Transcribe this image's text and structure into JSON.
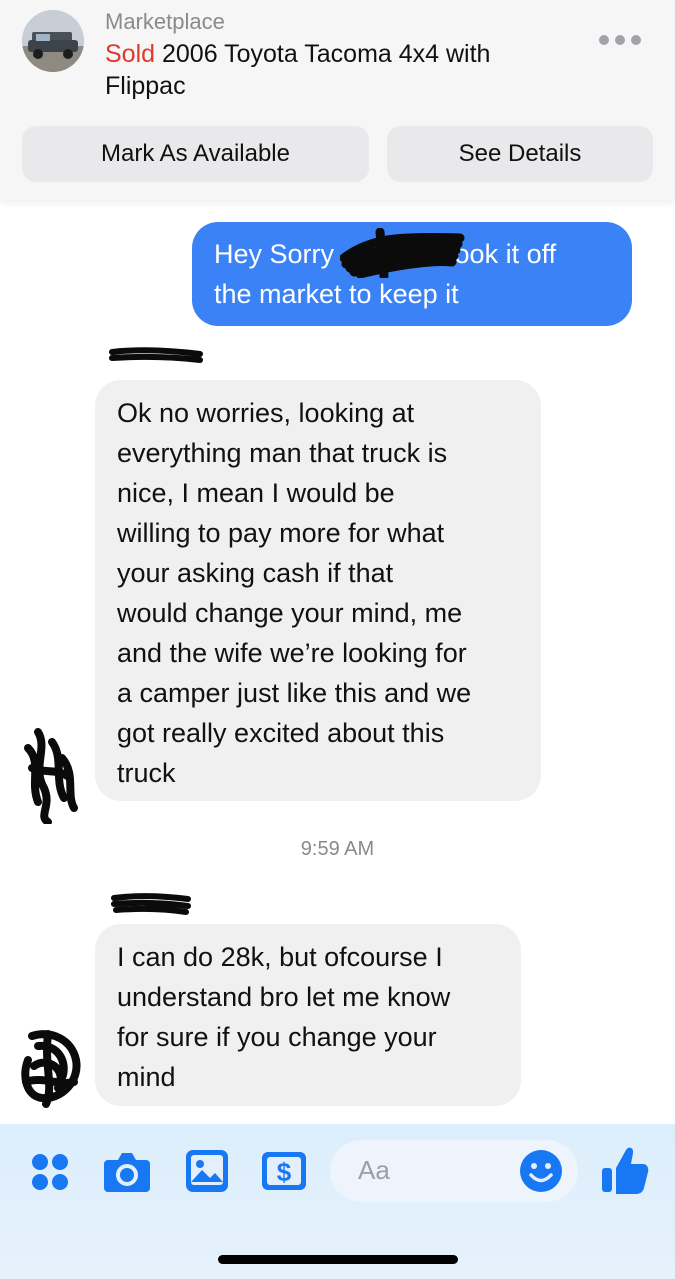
{
  "header": {
    "context_label": "Marketplace",
    "sold_label": "Sold",
    "title_line1": "2006 Toyota Tacoma 4x4 with",
    "title_line2": "Flippac",
    "more_icon": "more-horizontal-icon",
    "mark_available_label": "Mark As Available",
    "see_details_label": "See Details"
  },
  "messages": [
    {
      "direction": "outgoing",
      "lines": [
        "Hey Sorry",
        "I took it off",
        "the market to keep it"
      ]
    },
    {
      "direction": "incoming",
      "lines": [
        "Ok no worries, looking at",
        "everything man that truck is",
        "nice, I mean I would be",
        "willing to pay more for what",
        "your asking cash if that",
        "would change your mind, me",
        "and the wife we’re looking for",
        "a camper just like this and we",
        "got really excited about this",
        "truck"
      ]
    },
    {
      "direction": "incoming",
      "lines": [
        "I can do 28k, but ofcourse I",
        "understand bro let me know",
        "for sure if you change your",
        "mind"
      ]
    }
  ],
  "timestamp": "9:59 AM",
  "composer": {
    "placeholder": "Aa",
    "tools": [
      "apps-grid-icon",
      "camera-icon",
      "photo-gallery-icon",
      "payment-dollar-icon"
    ],
    "emoji_icon": "smiley-icon",
    "like_icon": "thumbs-up-icon"
  },
  "colors": {
    "outgoing_bubble": "#3b82f6",
    "incoming_bubble": "#f0f0f0",
    "sold": "#e0392b",
    "accent": "#1877f2"
  }
}
